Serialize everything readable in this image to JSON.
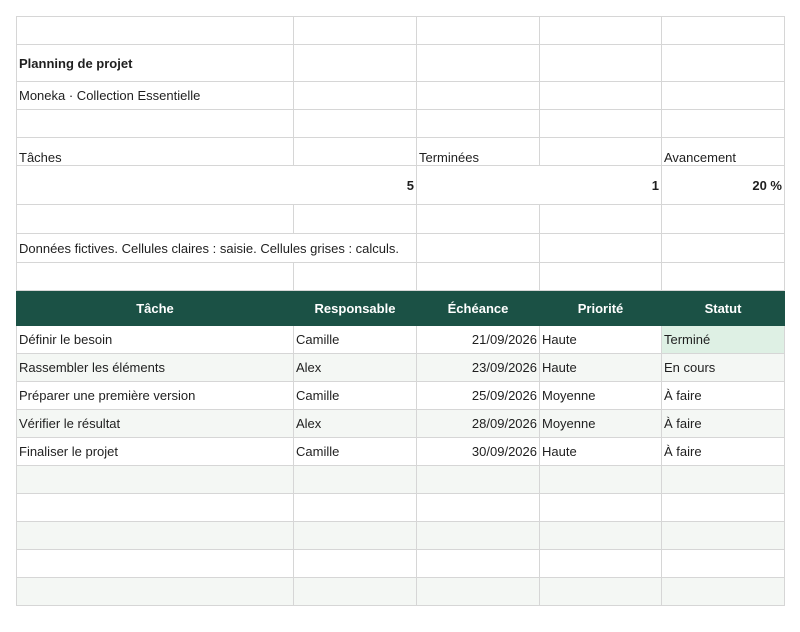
{
  "title": "Planning de projet",
  "subtitle": "Moneka · Collection Essentielle",
  "kpis": [
    {
      "label": "Tâches",
      "value": "5"
    },
    {
      "label": "Terminées",
      "value": "1"
    },
    {
      "label": "Avancement",
      "value": "20 %"
    }
  ],
  "note": "Données fictives. Cellules claires : saisie. Cellules grises : calculs.",
  "columns": [
    "Tâche",
    "Responsable",
    "Échéance",
    "Priorité",
    "Statut"
  ],
  "rows": [
    {
      "task": "Définir le besoin",
      "owner": "Camille",
      "due": "21/09/2026",
      "priority": "Haute",
      "status": "Terminé"
    },
    {
      "task": "Rassembler les éléments",
      "owner": "Alex",
      "due": "23/09/2026",
      "priority": "Haute",
      "status": "En cours"
    },
    {
      "task": "Préparer une première version",
      "owner": "Camille",
      "due": "25/09/2026",
      "priority": "Moyenne",
      "status": "À faire"
    },
    {
      "task": "Vérifier le résultat",
      "owner": "Alex",
      "due": "28/09/2026",
      "priority": "Moyenne",
      "status": "À faire"
    },
    {
      "task": "Finaliser le projet",
      "owner": "Camille",
      "due": "30/09/2026",
      "priority": "Haute",
      "status": "À faire"
    }
  ],
  "colors": {
    "header": "#1b5145",
    "accent": "#1b5145",
    "done_bg": "#def0e4",
    "alt_row": "#f4f7f4"
  }
}
